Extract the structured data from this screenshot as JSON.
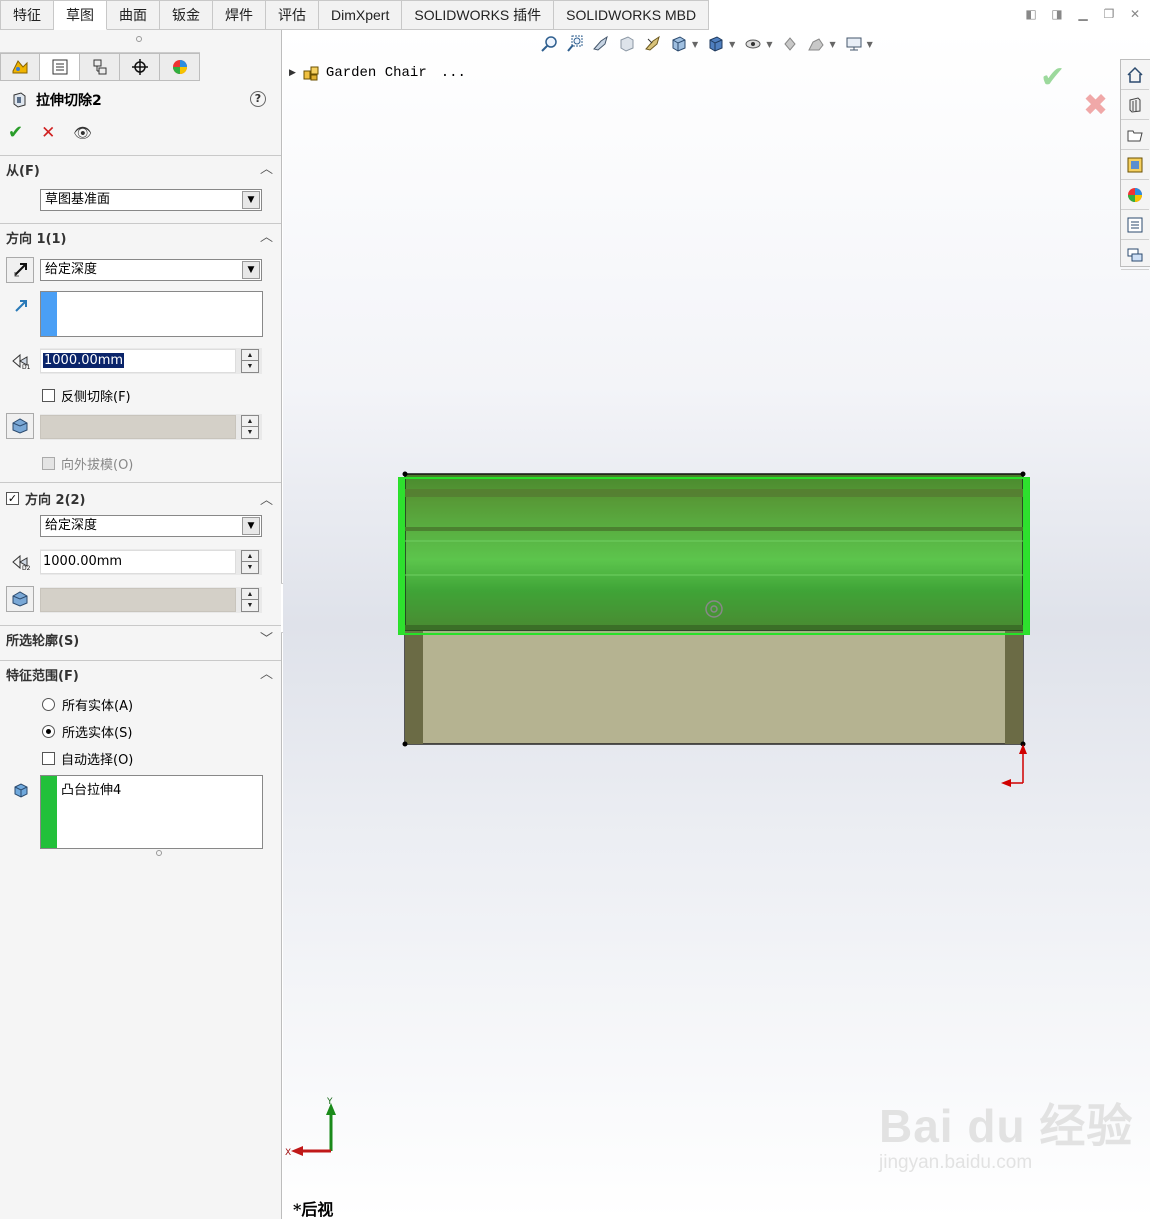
{
  "tabs": [
    {
      "label": "特征",
      "active": false
    },
    {
      "label": "草图",
      "active": true
    },
    {
      "label": "曲面",
      "active": false
    },
    {
      "label": "钣金",
      "active": false
    },
    {
      "label": "焊件",
      "active": false
    },
    {
      "label": "评估",
      "active": false
    },
    {
      "label": "DimXpert",
      "active": false
    },
    {
      "label": "SOLIDWORKS 插件",
      "active": false
    },
    {
      "label": "SOLIDWORKS MBD",
      "active": false
    }
  ],
  "property_manager": {
    "feature_title": "拉伸切除2",
    "help_label": "?",
    "from_section": {
      "title": "从(F)",
      "combo_value": "草图基准面"
    },
    "direction1": {
      "title": "方向 1(1)",
      "end_condition": "给定深度",
      "depth": "1000.00mm",
      "flip_side_label": "反侧切除(F)",
      "flip_side_checked": false,
      "draft_outward_label": "向外拔模(O)"
    },
    "direction2": {
      "title": "方向 2(2)",
      "checked": true,
      "end_condition": "给定深度",
      "depth": "1000.00mm"
    },
    "selected_contours": {
      "title": "所选轮廓(S)"
    },
    "feature_scope": {
      "title": "特征范围(F)",
      "all_bodies_label": "所有实体(A)",
      "selected_bodies_label": "所选实体(S)",
      "auto_select_label": "自动选择(O)",
      "selected_body_value": "凸台拉伸4",
      "selected_option": "selected_bodies",
      "auto_select_checked": false
    }
  },
  "viewport": {
    "tree_item": "Garden Chair",
    "tree_ellipsis": "...",
    "view_name": "*后视",
    "triad": {
      "y_label": "Y",
      "x_label": "X"
    },
    "watermark": {
      "brand": "Bai du 经验",
      "url": "jingyan.baidu.com"
    }
  },
  "colors": {
    "preview_green": "#3fbf3f",
    "body_olive": "#5a6b2f",
    "seat_beige": "#b5b391",
    "accent_blue": "#4a9ff5",
    "accent_green": "#22c03a"
  }
}
